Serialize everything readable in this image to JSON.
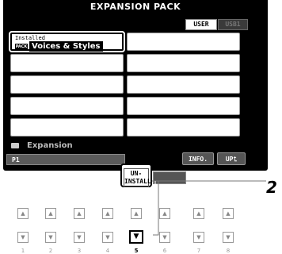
{
  "screen": {
    "title": "EXPANSION PACK",
    "tabs": [
      {
        "label": "USER",
        "active": true
      },
      {
        "label": "USB1",
        "active": false
      }
    ],
    "selected_item": {
      "status": "Installed",
      "badge": "PACK",
      "name": "Voices & Styles"
    },
    "folder_label": "Expansion",
    "page": "P1",
    "buttons": {
      "uninstall_line1": "UN-",
      "uninstall_line2": "INSTALL",
      "info": "INFO.",
      "up": "UP"
    }
  },
  "callout": "2",
  "panel_buttons": {
    "up_glyph": "▲",
    "down_glyph": "▼",
    "numbers": [
      "1",
      "2",
      "3",
      "4",
      "5",
      "6",
      "7",
      "8"
    ],
    "highlighted": "5"
  },
  "colors": {
    "screen_bg": "#000000",
    "cell_bg": "#ffffff",
    "button_bg": "#555555"
  }
}
